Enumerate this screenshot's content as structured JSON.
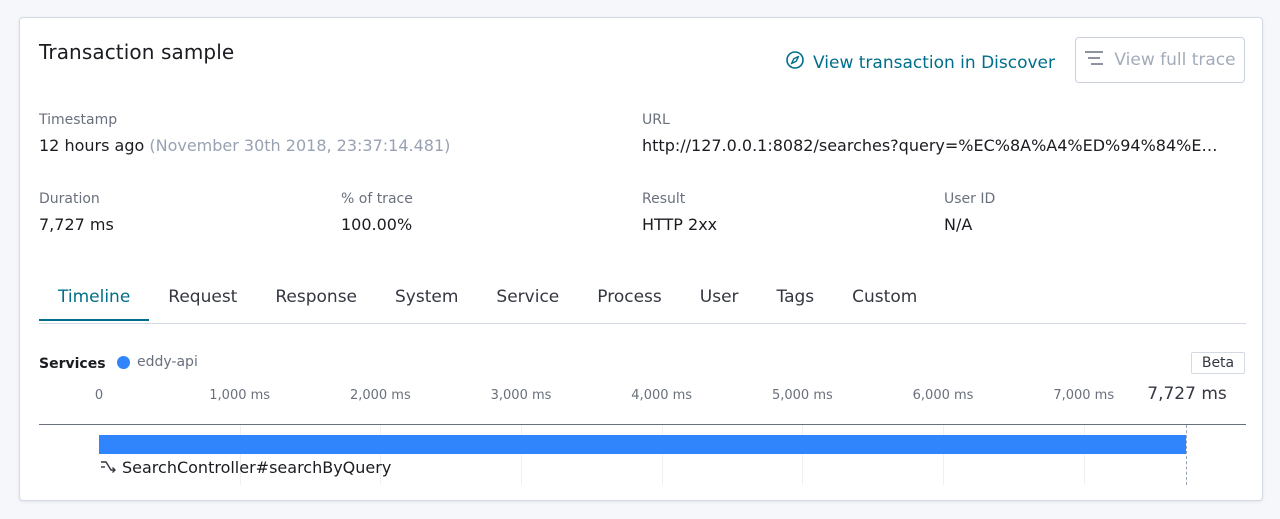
{
  "header": {
    "title": "Transaction sample",
    "discover_link": "View transaction in Discover",
    "full_trace_button": "View full trace"
  },
  "fields": {
    "timestamp": {
      "label": "Timestamp",
      "relative": "12 hours ago",
      "absolute": "(November 30th 2018, 23:37:14.481)"
    },
    "url": {
      "label": "URL",
      "value": "http://127.0.0.1:8082/searches?query=%EC%8A%A4%ED%94%84%EB%A…"
    },
    "duration": {
      "label": "Duration",
      "value": "7,727 ms"
    },
    "percent_of_trace": {
      "label": "% of trace",
      "value": "100.00%"
    },
    "result": {
      "label": "Result",
      "value": "HTTP 2xx"
    },
    "user_id": {
      "label": "User ID",
      "value": "N/A"
    }
  },
  "tabs": [
    {
      "label": "Timeline",
      "active": true
    },
    {
      "label": "Request",
      "active": false
    },
    {
      "label": "Response",
      "active": false
    },
    {
      "label": "System",
      "active": false
    },
    {
      "label": "Service",
      "active": false
    },
    {
      "label": "Process",
      "active": false
    },
    {
      "label": "User",
      "active": false
    },
    {
      "label": "Tags",
      "active": false
    },
    {
      "label": "Custom",
      "active": false
    }
  ],
  "timeline": {
    "services_label": "Services",
    "service_name": "eddy-api",
    "service_color": "#3185fc",
    "beta_badge": "Beta",
    "ticks": [
      "0",
      "1,000 ms",
      "2,000 ms",
      "3,000 ms",
      "4,000 ms",
      "5,000 ms",
      "6,000 ms",
      "7,000 ms"
    ],
    "tick_values_ms": [
      0,
      1000,
      2000,
      3000,
      4000,
      5000,
      6000,
      7000
    ],
    "total_label": "7,727 ms",
    "total_ms": 7727,
    "span": {
      "name": "SearchController#searchByQuery",
      "start_ms": 0,
      "duration_ms": 7727
    }
  },
  "colors": {
    "accent": "#006e8a",
    "span_bar": "#3185fc",
    "muted_text": "#98a2b3"
  }
}
